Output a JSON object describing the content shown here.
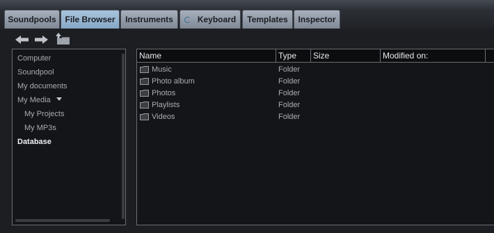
{
  "tabs": [
    {
      "label": "Soundpools",
      "active": false
    },
    {
      "label": "File Browser",
      "active": true
    },
    {
      "label": "Instruments",
      "active": false
    },
    {
      "label": "Keyboard",
      "active": false
    },
    {
      "label": "Templates",
      "active": false
    },
    {
      "label": "Inspector",
      "active": false
    }
  ],
  "toolbar": {
    "back_icon": "arrow-left-icon",
    "forward_icon": "arrow-right-icon",
    "up_icon": "folder-up-icon"
  },
  "tree": {
    "items": [
      {
        "label": "Computer"
      },
      {
        "label": "Soundpool"
      },
      {
        "label": "My documents"
      },
      {
        "label": "My Media"
      },
      {
        "label": "My Projects"
      },
      {
        "label": "My MP3s"
      },
      {
        "label": "Database"
      }
    ]
  },
  "table": {
    "columns": [
      "Name",
      "Type",
      "Size",
      "Modified on:"
    ],
    "rows": [
      {
        "name": "Music",
        "type": "Folder"
      },
      {
        "name": "Photo album",
        "type": "Folder"
      },
      {
        "name": "Photos",
        "type": "Folder"
      },
      {
        "name": "Playlists",
        "type": "Folder"
      },
      {
        "name": "Videos",
        "type": "Folder"
      }
    ]
  },
  "colors": {
    "active_tab": "#a9c4dc",
    "tab": "#a7b0bc",
    "panel_bg": "#141518",
    "border": "#6a6e75"
  }
}
